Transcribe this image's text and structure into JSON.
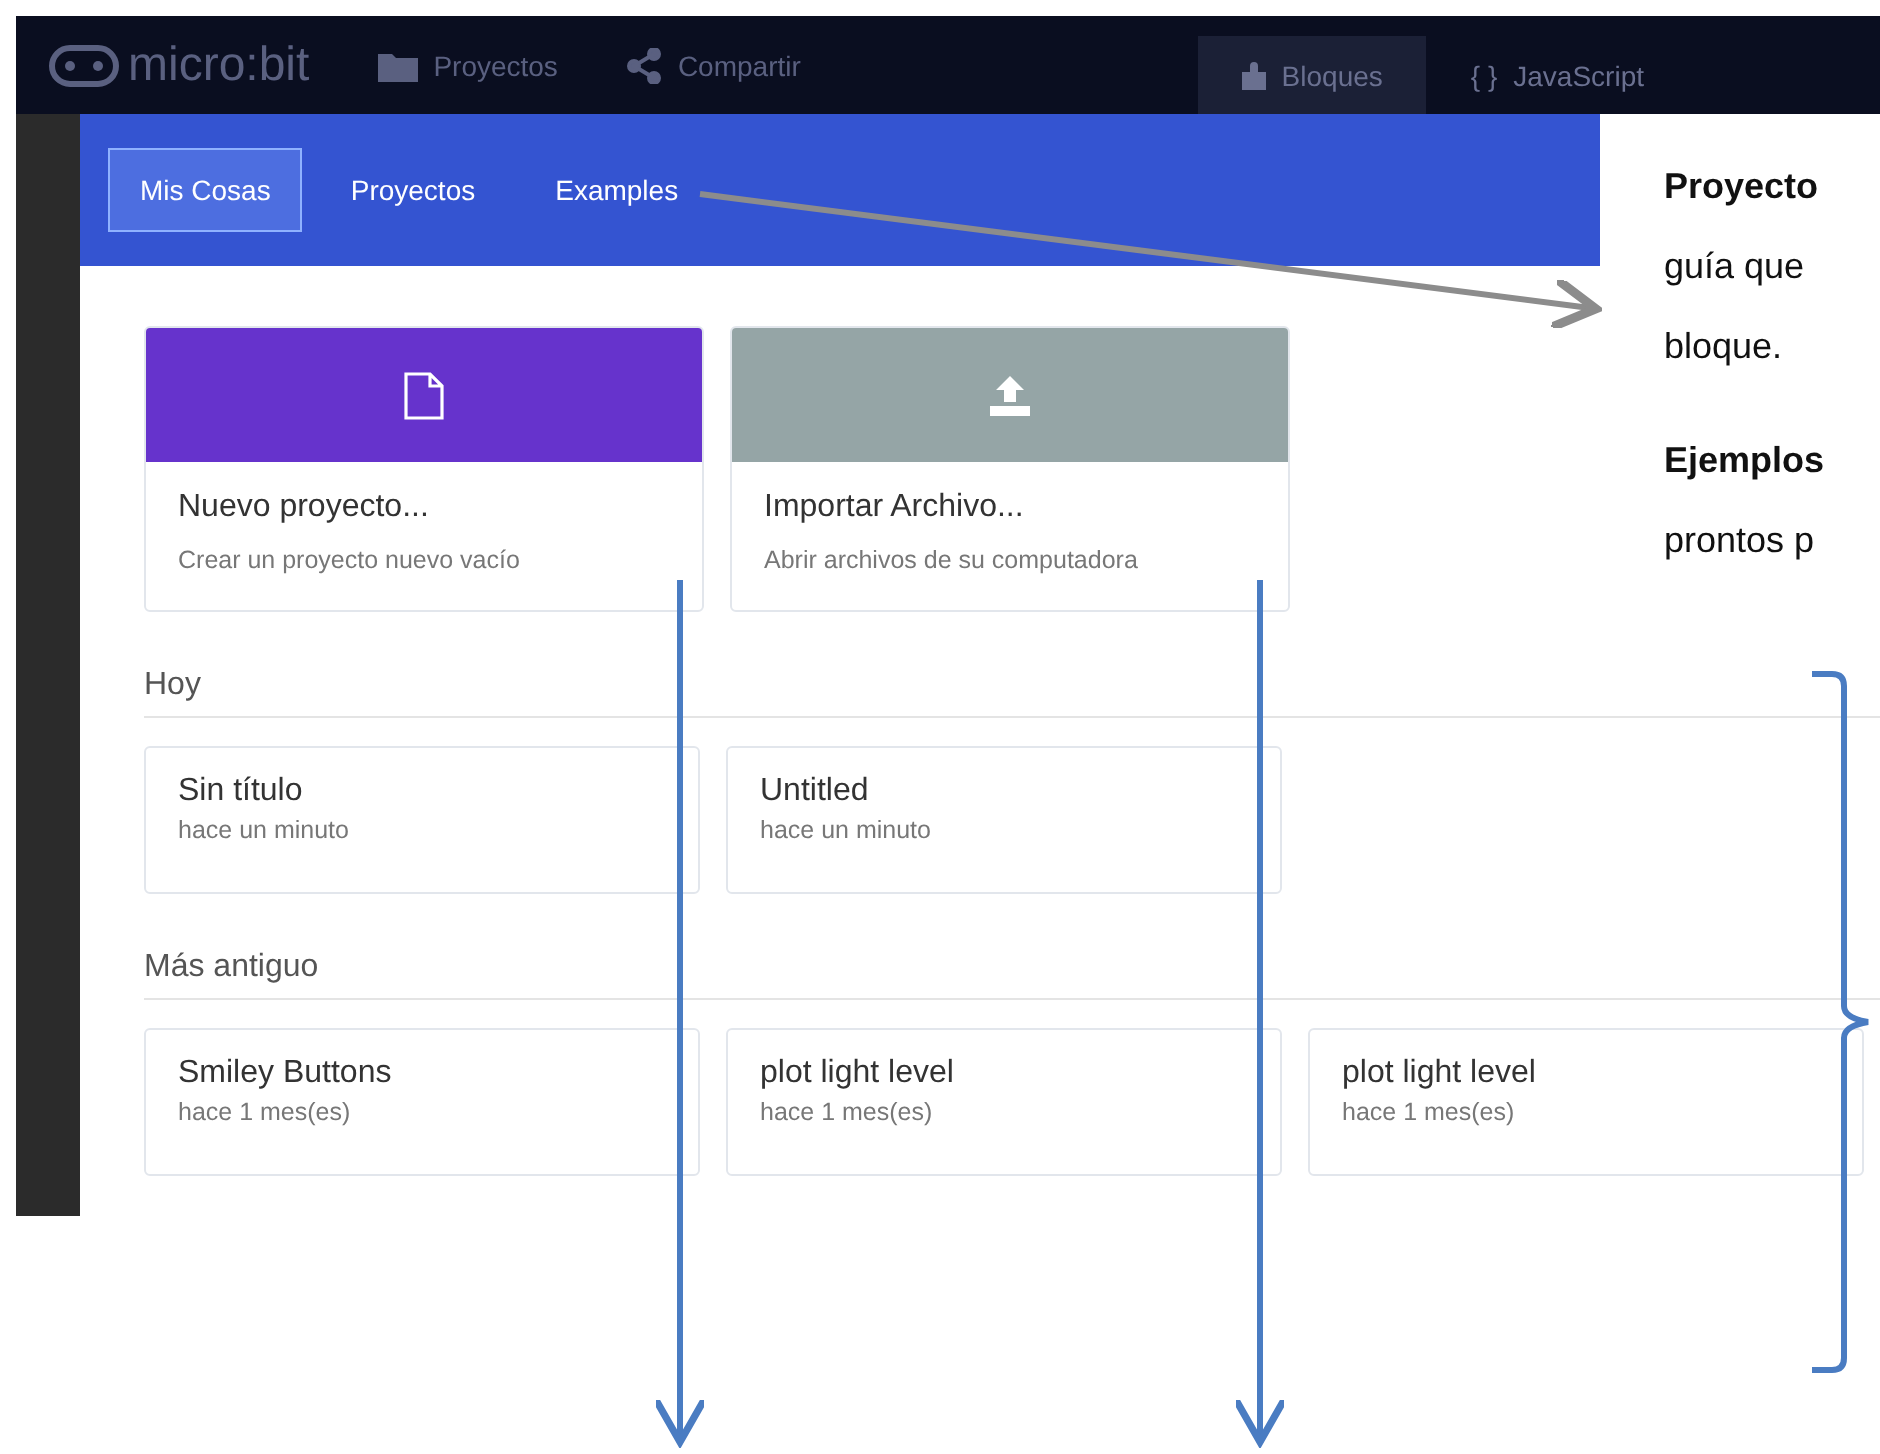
{
  "navbar": {
    "logo": "micro:bit",
    "items": [
      {
        "kind": "folder",
        "label": "Proyectos"
      },
      {
        "kind": "share",
        "label": "Compartir"
      }
    ],
    "editor_tabs": [
      {
        "kind": "blocks",
        "label": "Bloques",
        "selected": true
      },
      {
        "kind": "code",
        "glyph": "{ }",
        "label": "JavaScript",
        "selected": false
      }
    ]
  },
  "dialog": {
    "tabs": [
      {
        "label": "Mis Cosas",
        "selected": true
      },
      {
        "label": "Proyectos",
        "selected": false
      },
      {
        "label": "Examples",
        "selected": false
      }
    ],
    "actions": [
      {
        "kind": "new",
        "title": "Nuevo proyecto...",
        "subtitle": "Crear un proyecto nuevo vacío",
        "color": "#6633cc"
      },
      {
        "kind": "import",
        "title": "Importar Archivo...",
        "subtitle": "Abrir archivos de su computadora",
        "color": "#95a5a6"
      }
    ],
    "sections": [
      {
        "title": "Hoy",
        "projects": [
          {
            "name": "Sin título",
            "time": "hace un minuto"
          },
          {
            "name": "Untitled",
            "time": "hace un minuto"
          }
        ]
      },
      {
        "title": "Más antiguo",
        "projects": [
          {
            "name": "Smiley Buttons",
            "time": "hace 1 mes(es)"
          },
          {
            "name": "plot light level",
            "time": "hace 1 mes(es)"
          },
          {
            "name": "plot light level",
            "time": "hace 1 mes(es)"
          }
        ]
      }
    ]
  },
  "annotation": {
    "paragraphs": [
      [
        {
          "text": "Proyecto",
          "bold": true
        },
        {
          "text": "guía que",
          "bold": false
        },
        {
          "text": "bloque.",
          "bold": false
        }
      ],
      [
        {
          "text": "Ejemplos",
          "bold": true
        },
        {
          "text": "prontos p",
          "bold": false
        }
      ]
    ]
  }
}
